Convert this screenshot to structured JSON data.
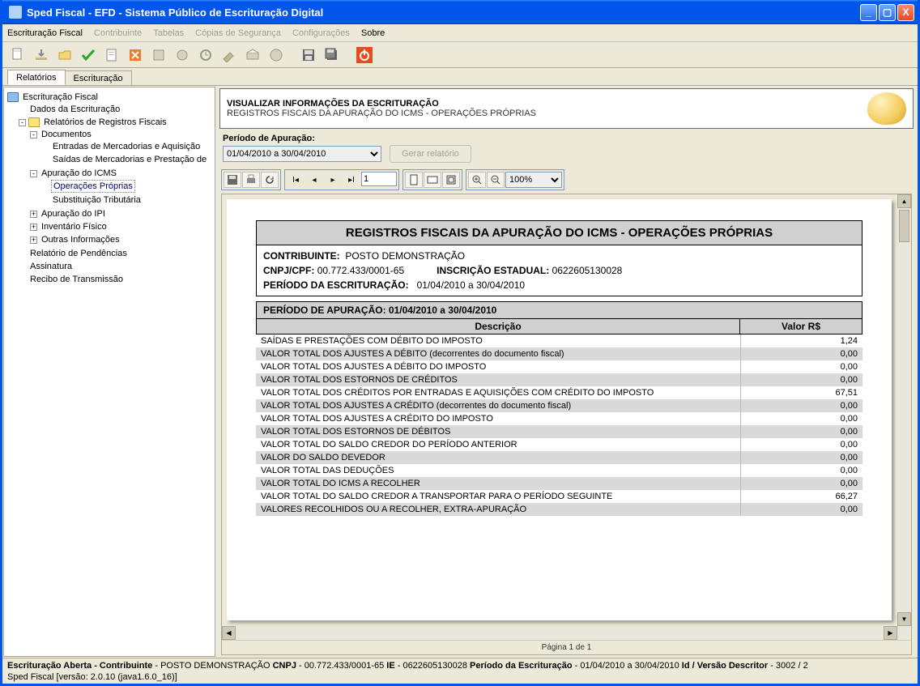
{
  "window": {
    "title": "Sped Fiscal - EFD - Sistema Público de Escrituração Digital"
  },
  "menu": {
    "escrituracao": "Escrituração Fiscal",
    "contribuinte": "Contribuinte",
    "tabelas": "Tabelas",
    "copias": "Cópias de Segurança",
    "config": "Configurações",
    "sobre": "Sobre"
  },
  "sidetabs": {
    "relatorios": "Relatórios",
    "escrituracao": "Escrituração"
  },
  "tree": {
    "root": "Escrituração Fiscal",
    "dados": "Dados da Escrituração",
    "relreg": "Relatórios de Registros Fiscais",
    "documentos": "Documentos",
    "entradas": "Entradas de Mercadorias e Aquisição ",
    "saidas": "Saídas de Mercadorias e Prestação de",
    "apur_icms": "Apuração do ICMS",
    "op_proprias": "Operações Próprias",
    "sub_trib": "Substituição Tributária",
    "apur_ipi": "Apuração do IPI",
    "inventario": "Inventário Físico",
    "outras": "Outras Informações",
    "pendencias": "Relatório de Pendências",
    "assinatura": "Assinatura",
    "recibo": "Recibo de Transmissão"
  },
  "infobox": {
    "line1": "VISUALIZAR INFORMAÇÕES DA ESCRITURAÇÃO",
    "line2": "REGISTROS FISCAIS DA APURAÇÃO DO ICMS - OPERAÇÕES PRÓPRIAS"
  },
  "period": {
    "label": "Período de Apuração:",
    "value": "01/04/2010 a 30/04/2010",
    "gen_btn": "Gerar relatório"
  },
  "viewer": {
    "page_field": "1",
    "zoom": "100%",
    "footer": "Página 1 de 1"
  },
  "report": {
    "title": "REGISTROS FISCAIS DA APURAÇÃO DO ICMS - OPERAÇÕES PRÓPRIAS",
    "contribuinte_lbl": "CONTRIBUINTE:",
    "contribuinte": "POSTO DEMONSTRAÇÃO",
    "cnpj_lbl": "CNPJ/CPF:",
    "cnpj": "00.772.433/0001-65",
    "ie_lbl": "INSCRIÇÃO ESTADUAL:",
    "ie": "0622605130028",
    "periodo_lbl": "PERÍODO DA ESCRITURAÇÃO:",
    "periodo": "01/04/2010 a 30/04/2010",
    "section_hdr": "PERÍODO DE APURAÇÃO: 01/04/2010 a 30/04/2010",
    "col_desc": "Descrição",
    "col_val": "Valor R$"
  },
  "chart_data": {
    "type": "table",
    "columns": [
      "Descrição",
      "Valor R$"
    ],
    "rows": [
      {
        "desc": "SAÍDAS E PRESTAÇÕES COM DÉBITO DO IMPOSTO",
        "value": "1,24"
      },
      {
        "desc": "VALOR TOTAL DOS AJUSTES A DÉBITO (decorrentes do documento fiscal)",
        "value": "0,00"
      },
      {
        "desc": "VALOR TOTAL DOS AJUSTES A DÉBITO DO IMPOSTO",
        "value": "0,00"
      },
      {
        "desc": "VALOR TOTAL DOS ESTORNOS DE CRÉDITOS",
        "value": "0,00"
      },
      {
        "desc": "VALOR TOTAL DOS CRÉDITOS POR ENTRADAS E AQUISIÇÕES COM CRÉDITO DO IMPOSTO",
        "value": "67,51"
      },
      {
        "desc": "VALOR TOTAL DOS AJUSTES A CRÉDITO (decorrentes do documento fiscal)",
        "value": "0,00"
      },
      {
        "desc": "VALOR TOTAL DOS AJUSTES A CRÉDITO DO IMPOSTO",
        "value": "0,00"
      },
      {
        "desc": "VALOR TOTAL DOS ESTORNOS DE DÉBITOS",
        "value": "0,00"
      },
      {
        "desc": "VALOR TOTAL DO SALDO CREDOR DO PERÍODO ANTERIOR",
        "value": "0,00"
      },
      {
        "desc": "VALOR DO SALDO DEVEDOR",
        "value": "0,00"
      },
      {
        "desc": "VALOR TOTAL DAS DEDUÇÕES",
        "value": "0,00"
      },
      {
        "desc": "VALOR TOTAL DO ICMS A RECOLHER",
        "value": "0,00"
      },
      {
        "desc": "VALOR TOTAL DO SALDO CREDOR A TRANSPORTAR PARA O PERÍODO SEGUINTE",
        "value": "66,27"
      },
      {
        "desc": "VALORES RECOLHIDOS OU A RECOLHER, EXTRA-APURAÇÃO",
        "value": "0,00"
      }
    ]
  },
  "status": {
    "l1a": "Escrituração Aberta - Contribuinte",
    "l1b": " - POSTO DEMONSTRAÇÃO ",
    "l1c": "CNPJ",
    "l1d": " - 00.772.433/0001-65 ",
    "l1e": "IE",
    "l1f": " - 0622605130028 ",
    "l1g": "Período da Escrituração",
    "l1h": " - 01/04/2010 a 30/04/2010 ",
    "l1i": "Id / Versão Descritor",
    "l1j": " - 3002 / 2",
    "l2": "Sped Fiscal [versão: 2.0.10 (java1.6.0_16)]"
  }
}
